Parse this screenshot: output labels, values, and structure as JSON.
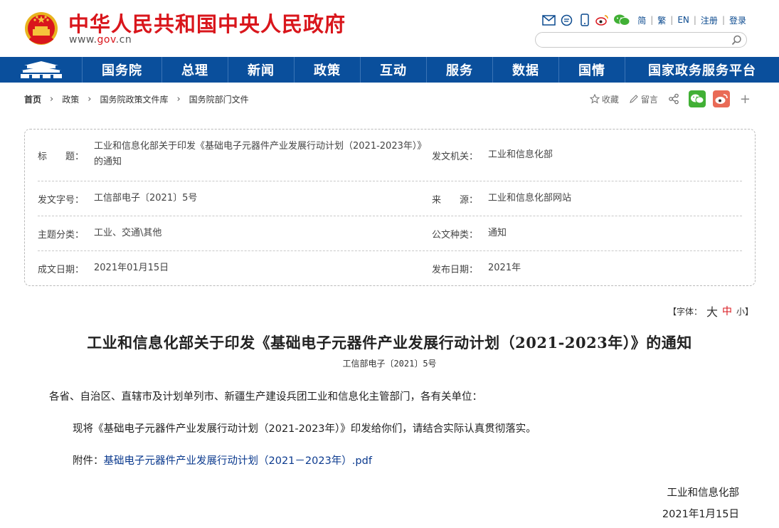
{
  "header": {
    "site_name": "中华人民共和国中央人民政府",
    "site_url_prefix": "www.",
    "site_url_gov": "gov",
    "site_url_suffix": ".cn",
    "links": [
      "简",
      "繁",
      "EN",
      "注册",
      "登录"
    ],
    "tool_icons": [
      "mail-icon",
      "message-icon",
      "mobile-icon",
      "weibo-icon",
      "wechat-icon"
    ],
    "search": {
      "value": "",
      "placeholder": ""
    },
    "brand_red": "#d9161c"
  },
  "nav": {
    "items": [
      "国务院",
      "总理",
      "新闻",
      "政策",
      "互动",
      "服务",
      "数据",
      "国情",
      "国家政务服务平台"
    ],
    "color": "#0a4f9c"
  },
  "breadcrumb": [
    "首页",
    "政策",
    "国务院政策文件库",
    "国务院部门文件"
  ],
  "share": {
    "favorite": "收藏",
    "comment": "留言"
  },
  "info": {
    "title_label": "标　　题：",
    "title_value": "工业和信息化部关于印发《基础电子元器件产业发展行动计划（2021-2023年）》的通知",
    "issuer_label": "发文机关：",
    "issuer_value": "工业和信息化部",
    "docno_label": "发文字号：",
    "docno_value": "工信部电子〔2021〕5号",
    "source_label": "来　　源：",
    "source_value": "工业和信息化部网站",
    "topic_label": "主题分类：",
    "topic_value": "工业、交通\\其他",
    "type_label": "公文种类：",
    "type_value": "通知",
    "written_label": "成文日期：",
    "written_value": "2021年01月15日",
    "published_label": "发布日期：",
    "published_value": "2021年"
  },
  "fontsize": {
    "prefix": "【字体：",
    "big": "大",
    "mid": "中",
    "small": "小",
    "suffix": "】"
  },
  "article": {
    "title": "工业和信息化部关于印发《基础电子元器件产业发展行动计划（2021-2023年）》的通知",
    "doc_no": "工信部电子〔2021〕5号",
    "salutation": "各省、自治区、直辖市及计划单列市、新疆生产建设兵团工业和信息化主管部门，各有关单位：",
    "body": "现将《基础电子元器件产业发展行动计划（2021-2023年）》印发给你们，请结合实际认真贯彻落实。",
    "attachment_label": "附件：",
    "attachment_link": "基础电子元器件产业发展行动计划（2021－2023年）.pdf",
    "signer": "工业和信息化部",
    "date": "2021年1月15日"
  }
}
